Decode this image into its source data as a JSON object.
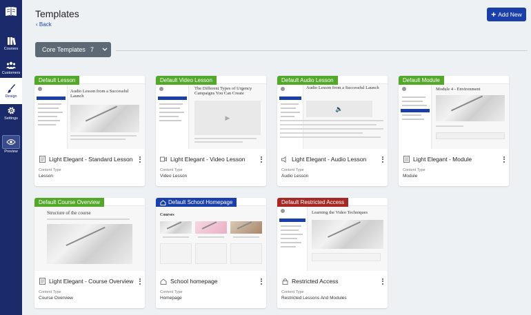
{
  "sidebar": {
    "items": [
      {
        "label": "Courses",
        "icon": "books-icon"
      },
      {
        "label": "Customers",
        "icon": "customers-icon"
      },
      {
        "label": "Design",
        "icon": "paintbrush-icon",
        "active": true
      },
      {
        "label": "Settings",
        "icon": "gear-icon"
      },
      {
        "label": "Preview",
        "icon": "eye-icon"
      }
    ]
  },
  "header": {
    "title": "Templates",
    "back_label": "Back",
    "add_button_label": "Add New"
  },
  "filter": {
    "label": "Core Templates",
    "count": "7"
  },
  "content_type_label": "Content Type",
  "cards": [
    {
      "badge": "Default Lesson",
      "badge_color": "#53a82a",
      "name": "Light Elegant - Standard Lesson",
      "icon": "document-icon",
      "content_type": "Lesson",
      "preview_heading": "Audio Lesson from a Successful Launch"
    },
    {
      "badge": "Default Video Lesson",
      "badge_color": "#53a82a",
      "name": "Light Elegant - Video Lesson",
      "icon": "video-icon",
      "content_type": "Video Lesson",
      "preview_heading": "The Different Types of Urgency Campaigns You Can Create"
    },
    {
      "badge": "Default Audio Lesson",
      "badge_color": "#53a82a",
      "name": "Light Elegant - Audio Lesson",
      "icon": "speaker-icon",
      "content_type": "Audio Lesson",
      "preview_heading": "Audio Lesson from a Successful Launch"
    },
    {
      "badge": "Default Module",
      "badge_color": "#53a82a",
      "name": "Light Elegant - Module",
      "icon": "list-icon",
      "content_type": "Module",
      "preview_heading": "Module 4 - Environment"
    },
    {
      "badge": "Default Course Overview",
      "badge_color": "#53a82a",
      "name": "Light Elegant - Course Overview",
      "icon": "document-icon",
      "content_type": "Course Overview",
      "preview_heading": "Structure of the course"
    },
    {
      "badge": "Default School Homepage",
      "badge_color": "#1b3fa8",
      "name": "School homepage",
      "icon": "home-icon",
      "content_type": "Homepage",
      "preview_heading": "Courses"
    },
    {
      "badge": "Default Restricted Access",
      "badge_color": "#a62824",
      "name": "Restricted Access",
      "icon": "lock-icon",
      "content_type": "Restricted Lessons And Modules",
      "preview_heading": "Learning the Video Techniques"
    }
  ]
}
